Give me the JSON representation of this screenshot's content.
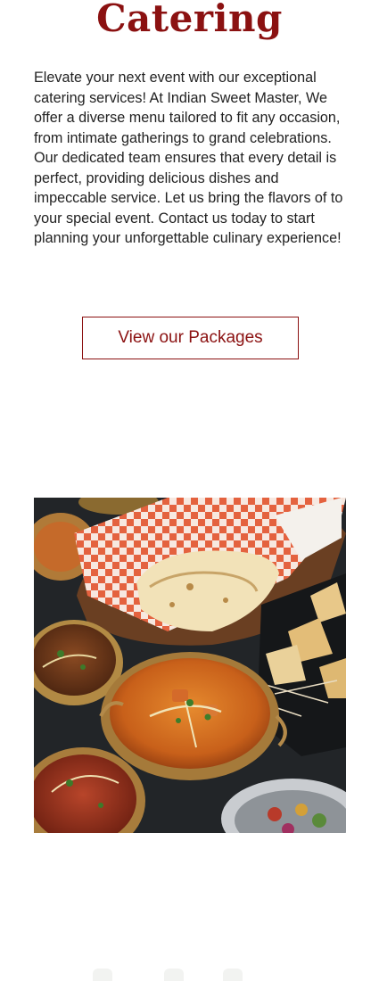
{
  "section": {
    "title": "Catering",
    "description": "Elevate your next event with our exceptional catering services! At Indian Sweet Master, We offer a diverse menu tailored to fit any occasion, from intimate gatherings to grand celebrations. Our dedicated team ensures that every detail is perfect, providing delicious dishes and impeccable service. Let us bring the flavors of to your special event. Contact us today to start planning your unforgettable culinary experience!",
    "button_label": "View our Packages",
    "image_alt": "Indian curry dishes with naan bread and samosas"
  },
  "colors": {
    "brand": "#8b1111",
    "text": "#222222",
    "background": "#ffffff"
  }
}
